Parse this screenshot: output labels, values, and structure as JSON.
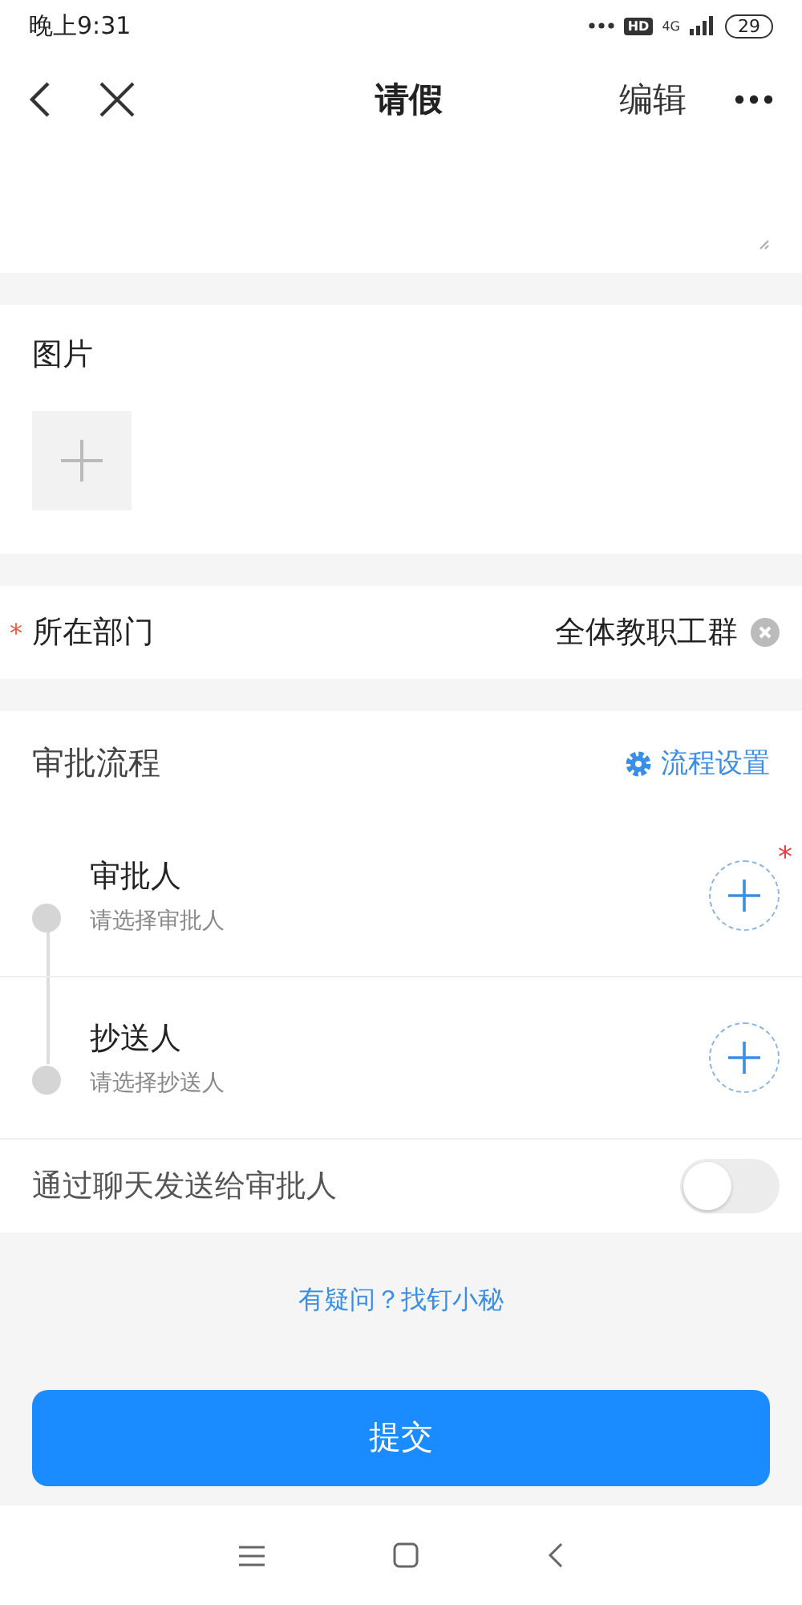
{
  "status_bar": {
    "time": "晚上9:31",
    "hd": "HD",
    "network": "4G",
    "battery": "29"
  },
  "nav": {
    "title": "请假",
    "edit": "编辑"
  },
  "images": {
    "title": "图片"
  },
  "department": {
    "required_mark": "*",
    "label": "所在部门",
    "value": "全体教职工群"
  },
  "approval": {
    "title": "审批流程",
    "settings": "流程设置",
    "steps": [
      {
        "title": "审批人",
        "hint": "请选择审批人",
        "required_mark": "*"
      },
      {
        "title": "抄送人",
        "hint": "请选择抄送人"
      }
    ]
  },
  "notify": {
    "label": "通过聊天发送给审批人",
    "on": false
  },
  "help_link": "有疑问？找钉小秘",
  "submit": "提交"
}
